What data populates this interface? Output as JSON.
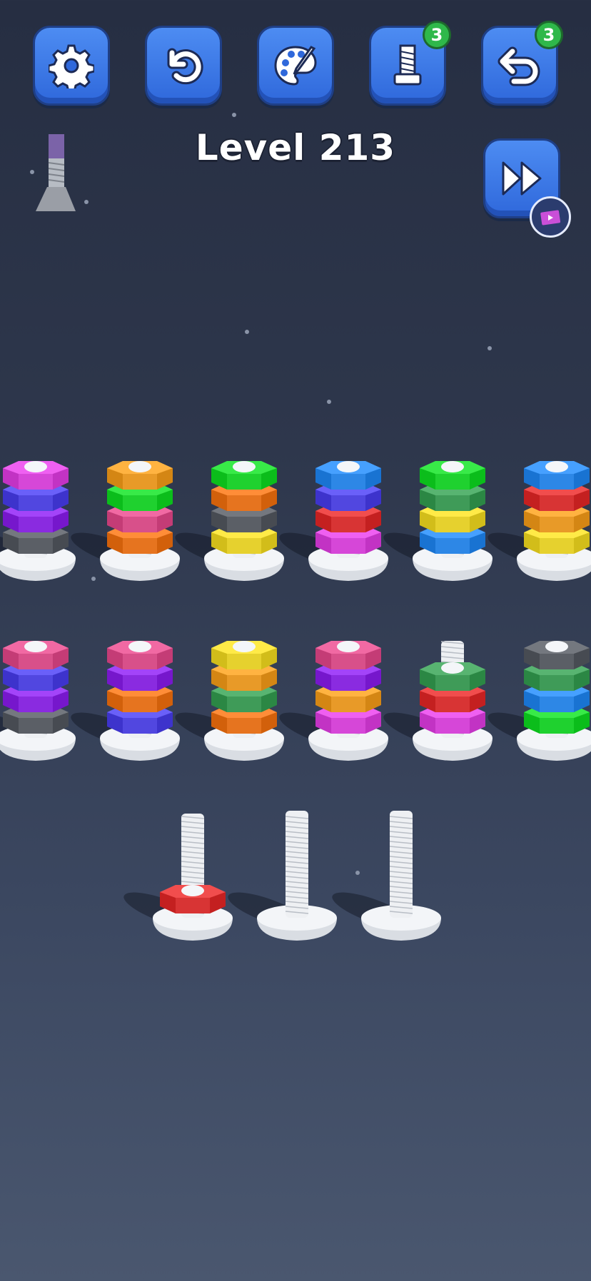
{
  "level": {
    "title": "Level 213"
  },
  "toolbar": {
    "settings": {
      "icon": "gear-icon"
    },
    "restart": {
      "icon": "restart-icon"
    },
    "theme": {
      "icon": "palette-icon"
    },
    "extra_bolt": {
      "icon": "bolt-icon",
      "count": "3"
    },
    "undo": {
      "icon": "undo-icon",
      "count": "3"
    },
    "skip": {
      "icon": "fast-forward-icon",
      "badge_icon": "video-ad-icon"
    }
  },
  "colors": {
    "purple": "#8a2be0",
    "magenta": "#d647d8",
    "blue": "#2d87e6",
    "indigo": "#5147e0",
    "orange": "#e6741f",
    "amber": "#e89a28",
    "green": "#1fd12f",
    "darkgreen": "#3f9b58",
    "red": "#d83434",
    "pink": "#d8508a",
    "yellow": "#e6d12e",
    "gray": "#5b5f66"
  },
  "bolts": [
    {
      "row": 1,
      "col": 1,
      "nuts": [
        "magenta",
        "indigo",
        "purple",
        "gray"
      ]
    },
    {
      "row": 1,
      "col": 2,
      "nuts": [
        "amber",
        "green",
        "pink",
        "orange"
      ]
    },
    {
      "row": 1,
      "col": 3,
      "nuts": [
        "green",
        "orange",
        "gray",
        "yellow"
      ]
    },
    {
      "row": 1,
      "col": 4,
      "nuts": [
        "blue",
        "indigo",
        "red",
        "magenta"
      ]
    },
    {
      "row": 1,
      "col": 5,
      "nuts": [
        "green",
        "darkgreen",
        "yellow",
        "blue"
      ]
    },
    {
      "row": 1,
      "col": 6,
      "nuts": [
        "blue",
        "red",
        "amber",
        "yellow"
      ]
    },
    {
      "row": 2,
      "col": 1,
      "nuts": [
        "pink",
        "indigo",
        "purple",
        "gray"
      ]
    },
    {
      "row": 2,
      "col": 2,
      "nuts": [
        "pink",
        "purple",
        "orange",
        "indigo"
      ]
    },
    {
      "row": 2,
      "col": 3,
      "nuts": [
        "yellow",
        "amber",
        "darkgreen",
        "orange"
      ]
    },
    {
      "row": 2,
      "col": 4,
      "nuts": [
        "pink",
        "purple",
        "amber",
        "magenta"
      ]
    },
    {
      "row": 2,
      "col": 5,
      "nuts": [
        "darkgreen",
        "red",
        "magenta"
      ]
    },
    {
      "row": 2,
      "col": 6,
      "nuts": [
        "gray",
        "darkgreen",
        "blue",
        "green"
      ]
    },
    {
      "row": 3,
      "col": 1,
      "nuts": [
        "red"
      ]
    },
    {
      "row": 3,
      "col": 2,
      "nuts": []
    },
    {
      "row": 3,
      "col": 3,
      "nuts": []
    }
  ]
}
